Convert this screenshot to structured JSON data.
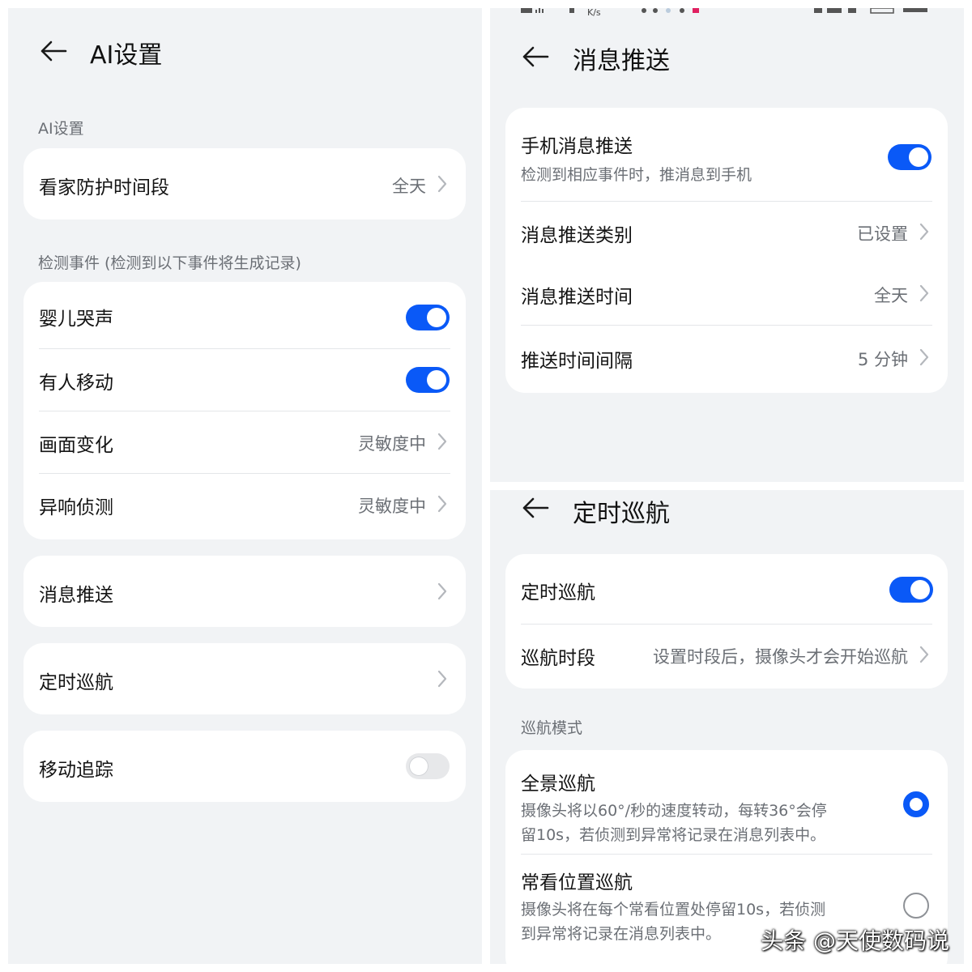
{
  "left": {
    "title": "AI设置",
    "section_ai": "AI设置",
    "protect_period": {
      "label": "看家防护时间段",
      "value": "全天"
    },
    "section_detect": "检测事件 (检测到以下事件将生成记录)",
    "detect_items": [
      {
        "label": "婴儿哭声",
        "toggle": "on"
      },
      {
        "label": "有人移动",
        "toggle": "on"
      },
      {
        "label": "画面变化",
        "value": "灵敏度中"
      },
      {
        "label": "异响侦测",
        "value": "灵敏度中"
      }
    ],
    "msg_push": {
      "label": "消息推送"
    },
    "timed_cruise": {
      "label": "定时巡航"
    },
    "motion_track": {
      "label": "移动追踪",
      "toggle": "off"
    }
  },
  "topright": {
    "statusbar_text": "K/s",
    "title": "消息推送",
    "phone_push": {
      "label": "手机消息推送",
      "desc": "检测到相应事件时，推消息到手机",
      "toggle": "on"
    },
    "push_type": {
      "label": "消息推送类别",
      "value": "已设置"
    },
    "push_time": {
      "label": "消息推送时间",
      "value": "全天"
    },
    "push_interval": {
      "label": "推送时间间隔",
      "value": "5 分钟"
    }
  },
  "bottomright": {
    "title": "定时巡航",
    "cruise": {
      "label": "定时巡航",
      "toggle": "on"
    },
    "cruise_period": {
      "label": "巡航时段",
      "value": "设置时段后，摄像头才会开始巡航"
    },
    "section_mode": "巡航模式",
    "modes": [
      {
        "label": "全景巡航",
        "desc_line1": "摄像头将以60°/秒的速度转动，每转36°会停",
        "desc_line2": "留10s，若侦测到异常将记录在消息列表中。",
        "selected": true
      },
      {
        "label": "常看位置巡航",
        "desc_line1": "摄像头将在每个常看位置处停留10s，若侦测",
        "desc_line2": "到异常将记录在消息列表中。",
        "selected": false
      }
    ]
  },
  "watermark": "头条 @天使数码说",
  "colors": {
    "accent": "#0a59f7",
    "bg": "#f1f3f5",
    "card": "#ffffff",
    "secondary_text": "#6b6f75"
  },
  "icons": {
    "back": "arrow-left-icon",
    "chevron": "chevron-right-icon",
    "radio": "radio-icon"
  }
}
